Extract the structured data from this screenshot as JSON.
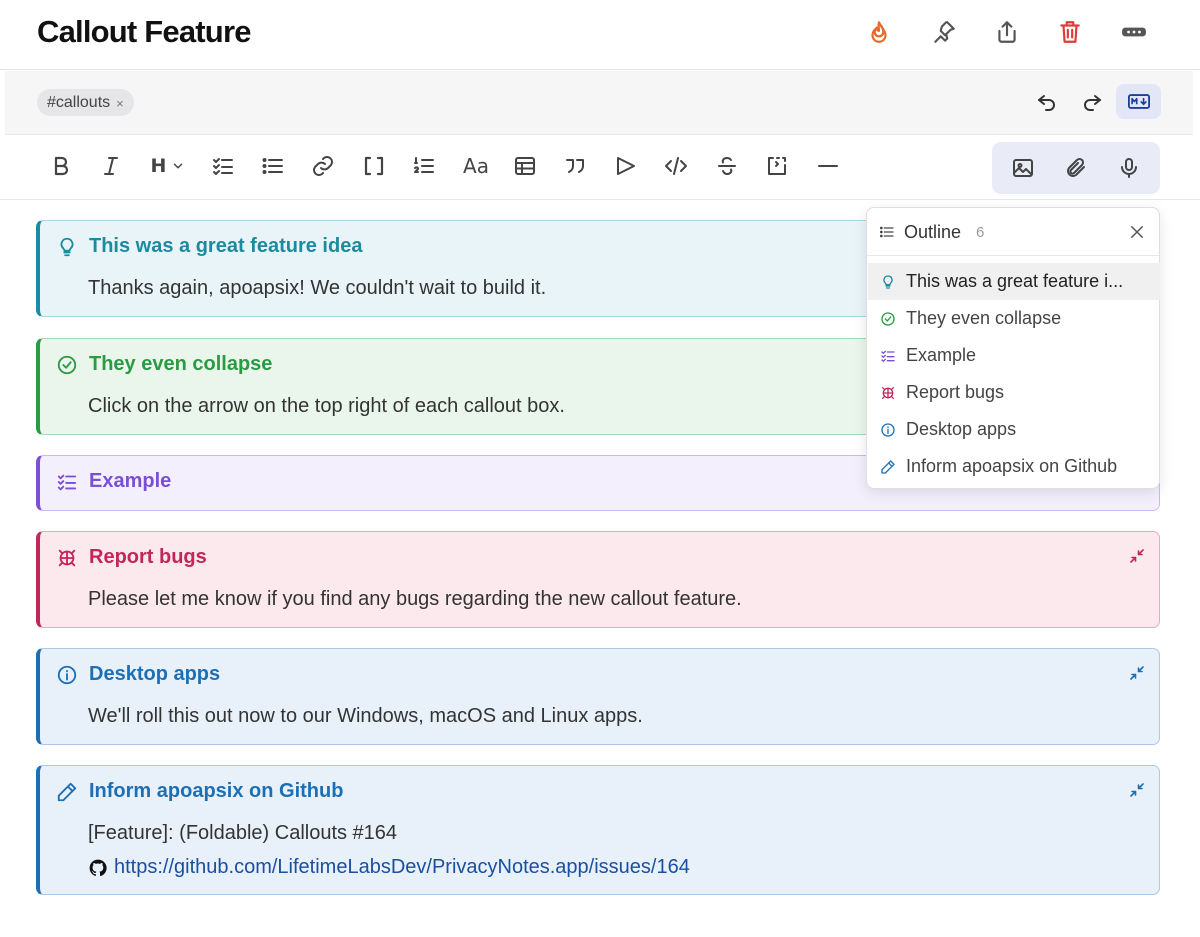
{
  "page": {
    "title": "Callout Feature"
  },
  "header_icons": [
    {
      "name": "flame-icon",
      "color": "#e8692a"
    },
    {
      "name": "pin-icon",
      "color": "#555555"
    },
    {
      "name": "share-icon",
      "color": "#555555"
    },
    {
      "name": "trash-icon",
      "color": "#e03a3a"
    },
    {
      "name": "more-icon",
      "color": "#555555"
    }
  ],
  "tags": [
    {
      "label": "#callouts",
      "remove": "×"
    }
  ],
  "tagbar": {
    "undo_icon": "undo-icon",
    "redo_icon": "redo-icon",
    "markdown_icon": "markdown-icon"
  },
  "toolbar": {
    "heading_label": "H",
    "font_label": "Aa",
    "buttons": [
      "bold-icon",
      "italic-icon",
      "heading-icon",
      "checklist-icon",
      "bullet-list-icon",
      "link-icon",
      "brackets-icon",
      "numbered-list-icon",
      "font-icon",
      "table-icon",
      "quote-icon",
      "callout-icon",
      "code-icon",
      "strikethrough-icon",
      "embed-icon",
      "divider-icon"
    ],
    "media": [
      "image-icon",
      "attachment-icon",
      "microphone-icon"
    ]
  },
  "callouts": [
    {
      "type": "idea",
      "icon": "lightbulb-icon",
      "title": "This was a great feature idea",
      "body": "Thanks again, apoapsix! We couldn't wait to build it.",
      "color": "#1c8aa1",
      "bg": "#e8f4f7",
      "border": "#a9d6e0"
    },
    {
      "type": "success",
      "icon": "check-circle-icon",
      "title": "They even collapse",
      "body": "Click on the arrow on the top right of each callout box.",
      "color": "#2b9a45",
      "bg": "#eaf6ec",
      "border": "#a8d9b1"
    },
    {
      "type": "example",
      "icon": "checklist-icon",
      "title": "Example",
      "color": "#7a4fd6",
      "bg": "#f3effd",
      "border": "#cbb9f1"
    },
    {
      "type": "bug",
      "icon": "bug-icon",
      "title": "Report bugs",
      "body": "Please let me know if you find any bugs regarding the new callout feature.",
      "color": "#c2265a",
      "bg": "#fbe9ee",
      "border": "#eeaabd"
    },
    {
      "type": "info",
      "icon": "info-icon",
      "title": "Desktop apps",
      "body": "We'll roll this out now to our Windows, macOS and Linux apps.",
      "color": "#1d6fb5",
      "bg": "#e8f1fa",
      "border": "#a9c9e8"
    },
    {
      "type": "note",
      "icon": "pencil-icon",
      "title": "Inform apoapsix on Github",
      "body": "[Feature]: (Foldable) Callouts #164",
      "link": "https://github.com/LifetimeLabsDev/PrivacyNotes.app/issues/164",
      "color": "#1d6fb5",
      "bg": "#e8f1fa",
      "border": "#a9c9e8"
    }
  ],
  "outline": {
    "title": "Outline",
    "count": "6",
    "items": [
      {
        "label": "This was a great feature i...",
        "icon": "lightbulb-icon",
        "color": "#1c8aa1"
      },
      {
        "label": "They even collapse",
        "icon": "check-circle-icon",
        "color": "#2b9a45"
      },
      {
        "label": "Example",
        "icon": "checklist-icon",
        "color": "#7a4fd6"
      },
      {
        "label": "Report bugs",
        "icon": "bug-icon",
        "color": "#c2265a"
      },
      {
        "label": "Desktop apps",
        "icon": "info-icon",
        "color": "#1d6fb5"
      },
      {
        "label": "Inform apoapsix on Github",
        "icon": "pencil-icon",
        "color": "#1d6fb5"
      }
    ]
  }
}
